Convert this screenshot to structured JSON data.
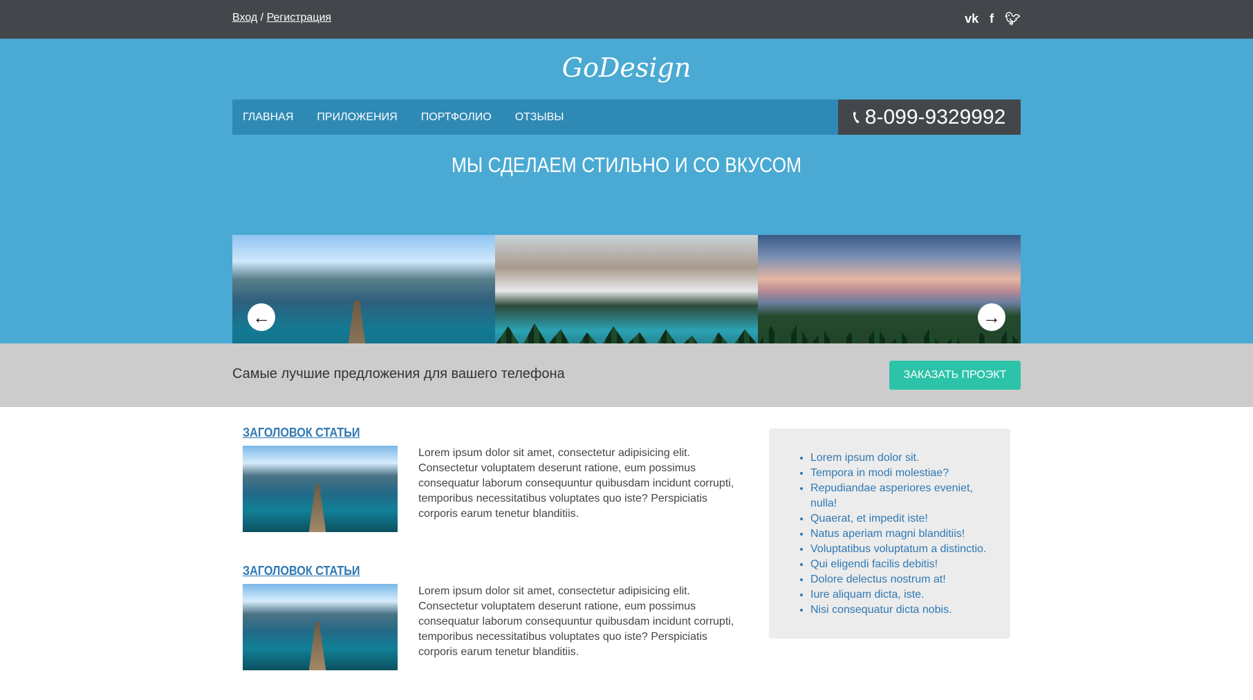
{
  "topbar": {
    "login": "Вход",
    "separator": "/",
    "register": "Регистрация",
    "social": [
      {
        "icon": "vk-icon",
        "glyph": "vk"
      },
      {
        "icon": "facebook-icon",
        "glyph": "f"
      },
      {
        "icon": "twitter-icon",
        "glyph": "t"
      }
    ]
  },
  "header": {
    "logo": "GoDesign",
    "nav": [
      "ГЛАВНАЯ",
      "ПРИЛОЖЕНИЯ",
      "ПОРТФОЛИО",
      "ОТЗЫВЫ"
    ],
    "phone": "8-099-9329992",
    "phone_icon": "phone-icon",
    "tagline": "МЫ СДЕЛАЕМ СТИЛЬНО И СО ВКУСОМ"
  },
  "offer": {
    "text": "Самые лучшие предложения для вашего телефона",
    "button": "ЗАКАЗАТЬ ПРОЭКТ"
  },
  "articles": [
    {
      "title": "ЗАГОЛОВОК СТАТЬИ",
      "text": "Lorem ipsum dolor sit amet, consectetur adipisicing elit. Consectetur voluptatem deserunt ratione, eum possimus consequatur laborum consequuntur quibusdam incidunt corrupti, temporibus necessitatibus voluptates quo iste? Perspiciatis corporis earum tenetur blanditiis."
    },
    {
      "title": "ЗАГОЛОВОК СТАТЬИ",
      "text": "Lorem ipsum dolor sit amet, consectetur adipisicing elit. Consectetur voluptatem deserunt ratione, eum possimus consequatur laborum consequuntur quibusdam incidunt corrupti, temporibus necessitatibus voluptates quo iste? Perspiciatis corporis earum tenetur blanditiis."
    }
  ],
  "sidebar": {
    "links": [
      "Lorem ipsum dolor sit.",
      "Tempora in modi molestiae?",
      "Repudiandae asperiores eveniet, nulla!",
      "Quaerat, et impedit iste!",
      "Natus aperiam magni blanditiis!",
      "Voluptatibus voluptatum a distinctio.",
      "Qui eligendi facilis debitis!",
      "Dolore delectus nostrum at!",
      "Iure aliquam dicta, iste.",
      "Nisi consequatur dicta nobis."
    ]
  },
  "colors": {
    "topbar": "#43464b",
    "header": "#4aaad3",
    "nav": "#2e8ab5",
    "offer_bar": "#cccccc",
    "order_button": "#2cc3a8",
    "link": "#2f78b3"
  }
}
